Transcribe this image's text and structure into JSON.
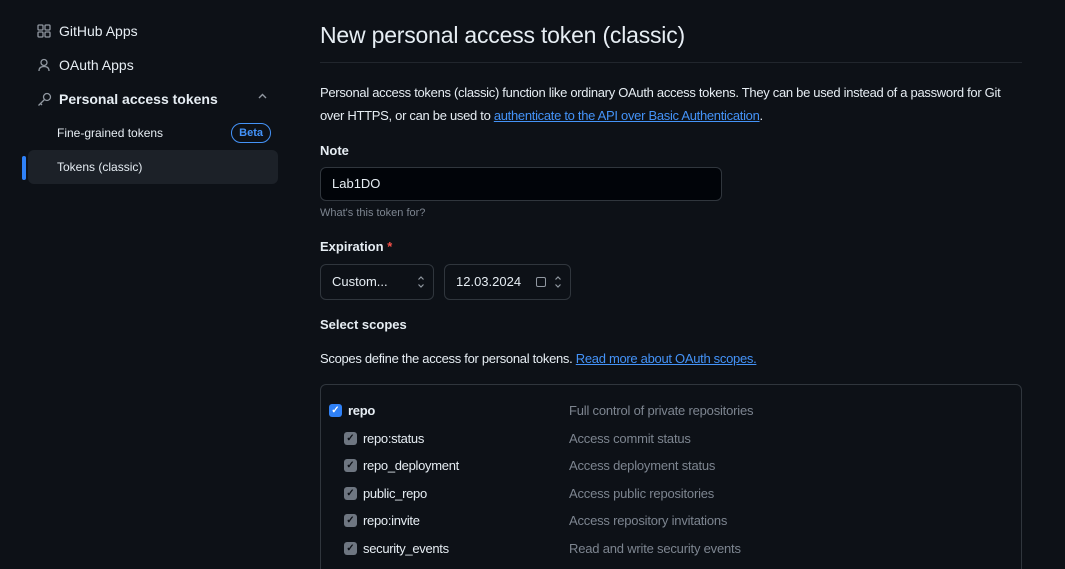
{
  "sidebar": {
    "items": [
      {
        "label": "GitHub Apps",
        "icon": "apps-grid-icon"
      },
      {
        "label": "OAuth Apps",
        "icon": "person-icon"
      },
      {
        "label": "Personal access tokens",
        "icon": "key-icon"
      }
    ],
    "sub_items": [
      {
        "label": "Fine-grained tokens",
        "badge": "Beta"
      },
      {
        "label": "Tokens (classic)",
        "active": true
      }
    ]
  },
  "main": {
    "title": "New personal access token (classic)",
    "description_text": "Personal access tokens (classic) function like ordinary OAuth access tokens. They can be used instead of a password for Git over HTTPS, or can be used to ",
    "description_link": "authenticate to the API over Basic Authentication",
    "description_end": ".",
    "note": {
      "label": "Note",
      "value": "Lab1DO",
      "hint": "What's this token for?"
    },
    "expiration": {
      "label": "Expiration",
      "required_mark": "*",
      "option": "Custom...",
      "date": "12.03.2024"
    },
    "scopes": {
      "label": "Select scopes",
      "description": "Scopes define the access for personal tokens. ",
      "link": "Read more about OAuth scopes.",
      "rows": [
        {
          "name": "repo",
          "desc": "Full control of private repositories",
          "checked": true,
          "level": 0
        },
        {
          "name": "repo:status",
          "desc": "Access commit status",
          "checked": true,
          "level": 1
        },
        {
          "name": "repo_deployment",
          "desc": "Access deployment status",
          "checked": true,
          "level": 1
        },
        {
          "name": "public_repo",
          "desc": "Access public repositories",
          "checked": true,
          "level": 1
        },
        {
          "name": "repo:invite",
          "desc": "Access repository invitations",
          "checked": true,
          "level": 1
        },
        {
          "name": "security_events",
          "desc": "Read and write security events",
          "checked": true,
          "level": 1
        }
      ]
    }
  },
  "colors": {
    "background": "#0d1117",
    "accent": "#2f81f7",
    "link": "#4493f8",
    "required": "#f85149"
  }
}
